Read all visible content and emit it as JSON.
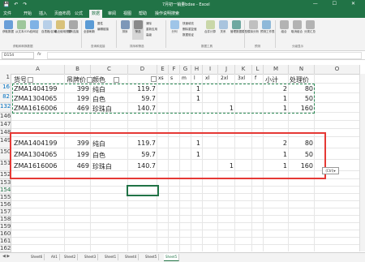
{
  "window": {
    "title": "7月初一销量bdxe - Excel",
    "quick_access": "💾 ↶ ↷",
    "window_controls": "— ☐ ✕"
  },
  "ribbon_tabs": [
    "文件",
    "开始",
    "插入",
    "页面布局",
    "公式",
    "数据",
    "审阅",
    "视图",
    "帮助",
    "操作说明搜索"
  ],
  "ribbon": {
    "active_tab_index": 5,
    "buttons": [
      "获取数据",
      "从文本/CSV",
      "自网站",
      "自表格/区域",
      "最近使用的源",
      "现有连接",
      "全部刷新",
      "属性",
      "编辑链接",
      "排序",
      "筛选",
      "清除",
      "重新应用",
      "高级",
      "分列",
      "快速填充",
      "删除重复值",
      "数据验证",
      "合并计算",
      "关系",
      "管理数据模型",
      "模拟分析",
      "预测工作表",
      "组合",
      "取消组合",
      "分类汇总"
    ],
    "groups": [
      "获取和转换数据",
      "查询和连接",
      "排序和筛选",
      "数据工具",
      "预测",
      "分级显示"
    ]
  },
  "formula_bar": {
    "name_box": "D154",
    "fx_label": "fx",
    "content": ""
  },
  "columns": [
    "A",
    "B",
    "C",
    "D",
    "E",
    "F",
    "G",
    "H",
    "I",
    "J",
    "K",
    "L",
    "M",
    "N",
    "O"
  ],
  "header_row": {
    "row_num": "1",
    "cells": [
      "货号",
      "吊牌价",
      "颜色",
      "",
      "xs",
      "s",
      "m",
      "l",
      "xl",
      "2xl",
      "3xl",
      "f",
      "小计",
      "处理价"
    ]
  },
  "filtered_rows": [
    {
      "row_num": "16",
      "a": "ZMA1404199",
      "b": "399",
      "c": "纯白",
      "d": "119.7",
      "h": "1",
      "m": "2",
      "n": "80"
    },
    {
      "row_num": "82",
      "a": "ZMA1304065",
      "b": "199",
      "c": "白色",
      "d": "59.7",
      "h": "1",
      "m": "1",
      "n": "50"
    },
    {
      "row_num": "132",
      "a": "ZMA1616006",
      "b": "469",
      "c": "珍珠白",
      "d": "140.7",
      "j": "1",
      "m": "1",
      "n": "160"
    }
  ],
  "empty_rows": [
    "146",
    "147",
    "148"
  ],
  "pasted_rows": [
    {
      "row_num": "149",
      "a": "ZMA1404199",
      "b": "399",
      "c": "纯白",
      "d": "119.7",
      "h": "1",
      "m": "2",
      "n": "80"
    },
    {
      "row_num": "150",
      "a": "ZMA1304065",
      "b": "199",
      "c": "白色",
      "d": "59.7",
      "h": "1",
      "m": "1",
      "n": "50"
    },
    {
      "row_num": "151",
      "a": "ZMA1616006",
      "b": "469",
      "c": "珍珠白",
      "d": "140.7",
      "j": "1",
      "m": "1",
      "n": "160"
    }
  ],
  "trailing_rows": [
    "152",
    "153",
    "154",
    "155",
    "156",
    "157",
    "158",
    "159",
    "160",
    "161",
    "162",
    "163",
    "164",
    "165",
    "166",
    "167",
    "168",
    "169",
    "170"
  ],
  "paste_options_label": "(Ctrl)▾",
  "sheet_tabs": [
    "Sheet6",
    "Ah1",
    "Sheet2",
    "Sheet3",
    "Sheet1",
    "Sheet4",
    "Sheet5",
    "Sheet5"
  ],
  "sheet_nav": "◀ ▶",
  "colors": {
    "excel_green": "#217346",
    "red_highlight": "#e53935",
    "filtered_row_num": "#0070c0"
  }
}
